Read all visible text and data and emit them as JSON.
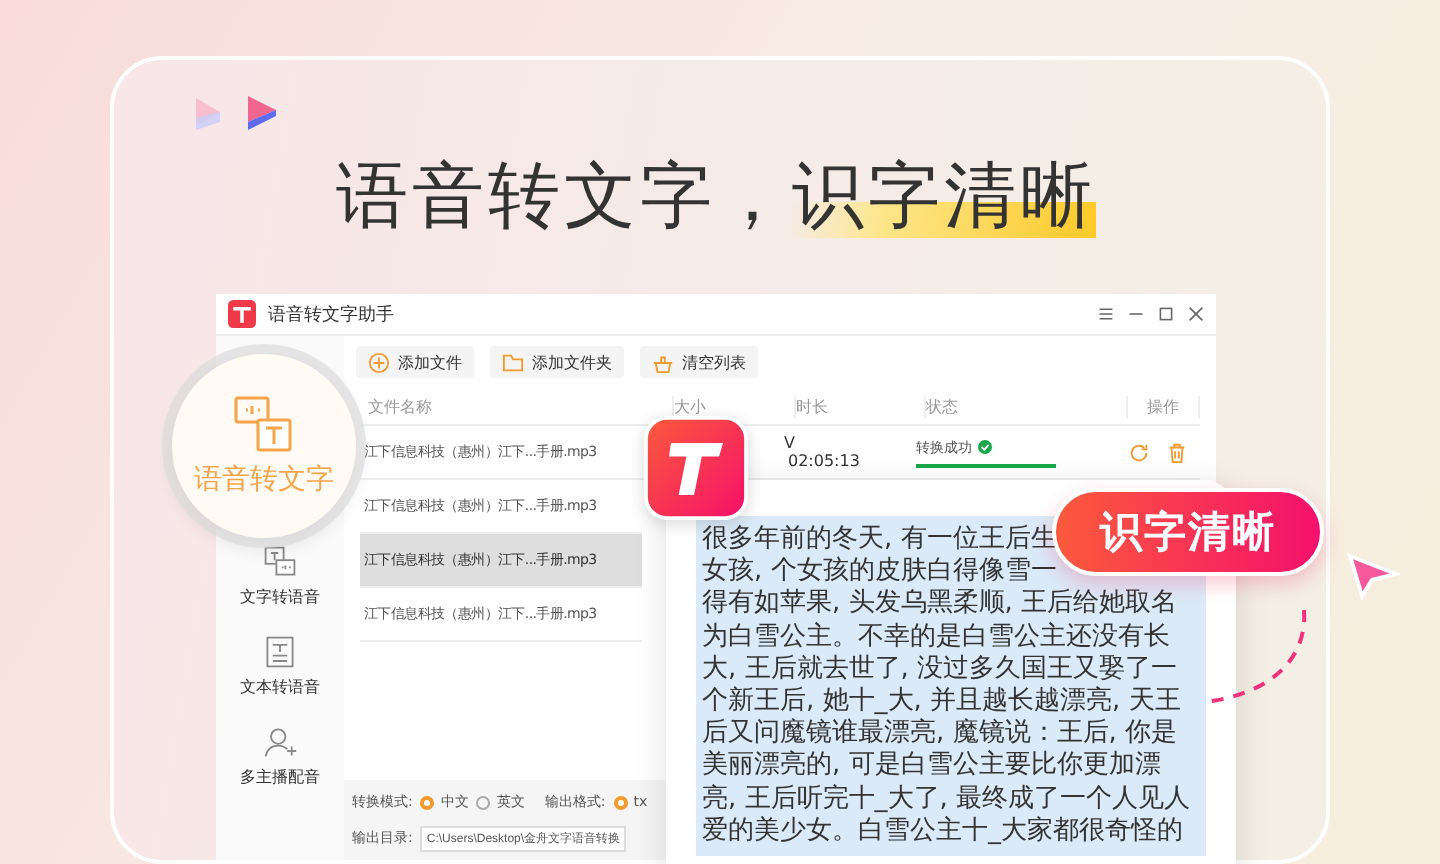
{
  "heading": {
    "main": "语音转文字，",
    "highlight": "识字清晰"
  },
  "window": {
    "title": "语音转文字助手"
  },
  "sidebar": {
    "items": [
      {
        "label": "语音转文字",
        "selected": true,
        "kind": "speech"
      },
      {
        "label": "文字转语音",
        "selected": false,
        "kind": "tts"
      },
      {
        "label": "文本转语音",
        "selected": false,
        "kind": "doc"
      },
      {
        "label": "多主播配音",
        "selected": false,
        "kind": "person"
      }
    ]
  },
  "toolbar": [
    {
      "label": "添加文件",
      "kind": "add"
    },
    {
      "label": "添加文件夹",
      "kind": "folder"
    },
    {
      "label": "清空列表",
      "kind": "clear"
    }
  ],
  "table": {
    "columns": [
      "文件名称",
      "大小",
      "时长",
      "状态",
      "操作"
    ],
    "rows": [
      {
        "name": "江下信息科技（惠州）江下...手册.mp3",
        "selected": false,
        "duration_mark": "V",
        "duration": "02:05:13",
        "status": "转换成功",
        "level": 1
      },
      {
        "name": "江下信息科技（惠州）江下...手册.mp3",
        "selected": false
      },
      {
        "name": "江下信息科技（惠州）江下...手册.mp3",
        "selected": true
      },
      {
        "name": "江下信息科技（惠州）江下...手册.mp3",
        "selected": false
      }
    ]
  },
  "options": {
    "mode_label": "转换模式:",
    "modes": [
      {
        "label": "中文",
        "selected": true
      },
      {
        "label": "英文",
        "selected": false
      }
    ],
    "format_label": "输出格式:",
    "formats": [
      {
        "label": "tx",
        "selected": true
      }
    ],
    "dir_label": "输出目录:",
    "dir_value": "C:\\Users\\Desktop\\金舟文字语音转换"
  },
  "result_lines": [
    "很多年前的冬天, 有一位王后生",
    "女孩, 个女孩的皮肤白得像雪一",
    "得有如苹果, 头发乌黑柔顺, 王后给她取名",
    "为白雪公主。不幸的是白雪公主还没有长",
    "大, 王后就去世了, 没过多久国王又娶了一",
    "个新王后, 她十_大, 并且越长越漂亮, 天王",
    "后又问魔镜谁最漂亮, 魔镜说：王后, 你是",
    "美丽漂亮的, 可是白雪公主要比你更加漂",
    "亮, 王后听完十_大了, 最终成了一个人见人",
    "爱的美少女。白雪公主十_大家都很奇怪的"
  ],
  "badge": "识字清晰"
}
